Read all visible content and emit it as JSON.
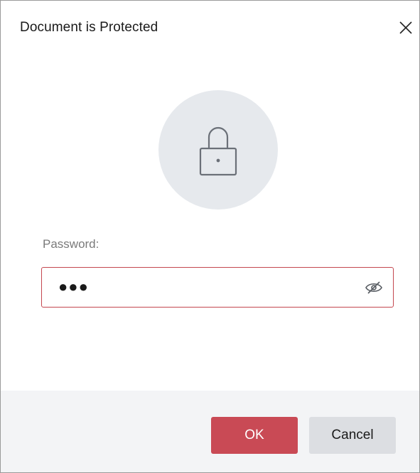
{
  "dialog": {
    "title": "Document is Protected",
    "close_icon": "close-icon"
  },
  "lock": {
    "icon": "lock-icon"
  },
  "password": {
    "label": "Password:",
    "value": "●●●",
    "toggle_icon": "eye-slash-icon"
  },
  "footer": {
    "ok_label": "OK",
    "cancel_label": "Cancel"
  },
  "colors": {
    "accent": "#c94a55",
    "field_border": "#c4474f",
    "lock_circle": "#e6e9ed",
    "footer_bg": "#f3f4f6",
    "cancel_bg": "#dcdee2"
  }
}
